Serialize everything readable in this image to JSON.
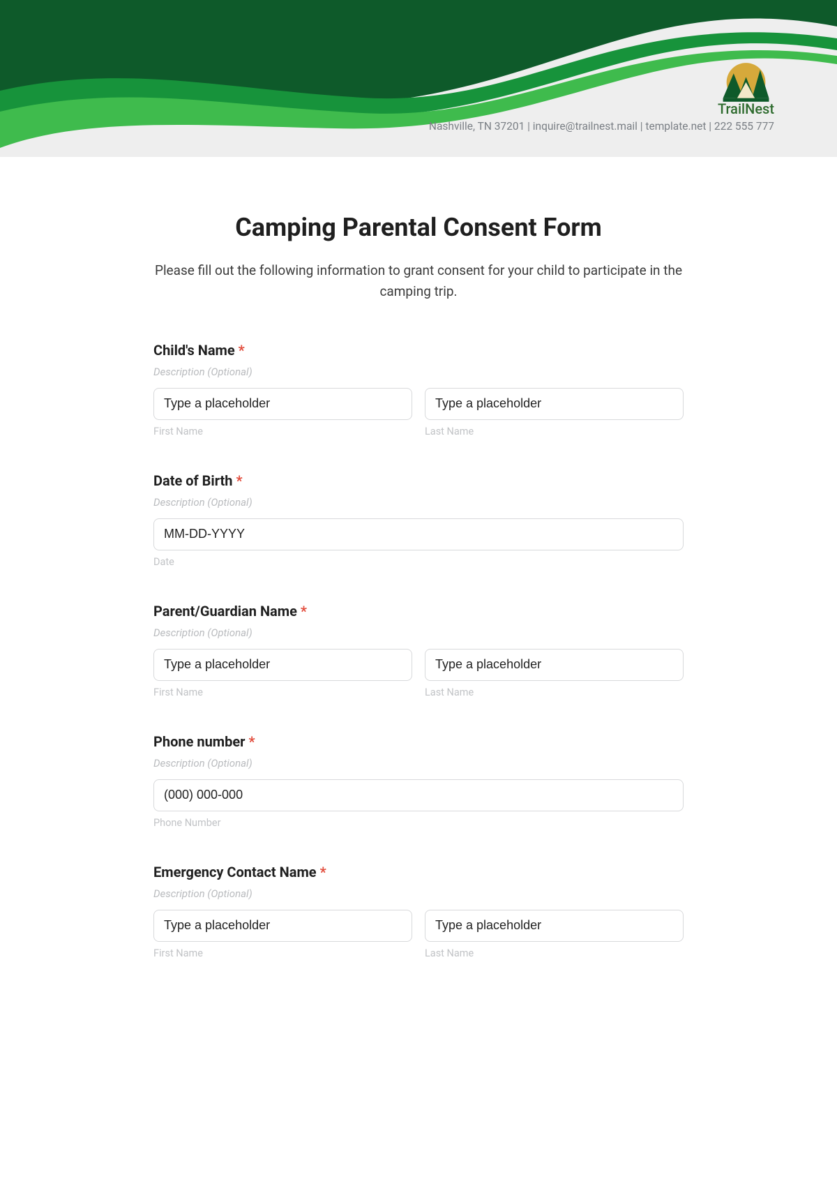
{
  "brand": {
    "name": "TrailNest",
    "contact": "Nashville, TN 37201 | inquire@trailnest.mail | template.net | 222 555 777"
  },
  "form": {
    "title": "Camping Parental Consent Form",
    "intro": "Please fill out the following information to grant consent for your child to participate in the camping trip.",
    "desc_placeholder": "Description (Optional)",
    "common": {
      "name_placeholder": "Type a placeholder",
      "first_name": "First Name",
      "last_name": "Last Name"
    },
    "fields": {
      "child_name": {
        "label": "Child's Name"
      },
      "dob": {
        "label": "Date of Birth",
        "placeholder": "MM-DD-YYYY",
        "sub": "Date"
      },
      "guardian": {
        "label": "Parent/Guardian Name"
      },
      "phone": {
        "label": "Phone number",
        "placeholder": "(000) 000-000",
        "sub": "Phone Number"
      },
      "emergency": {
        "label": "Emergency Contact Name"
      }
    }
  }
}
